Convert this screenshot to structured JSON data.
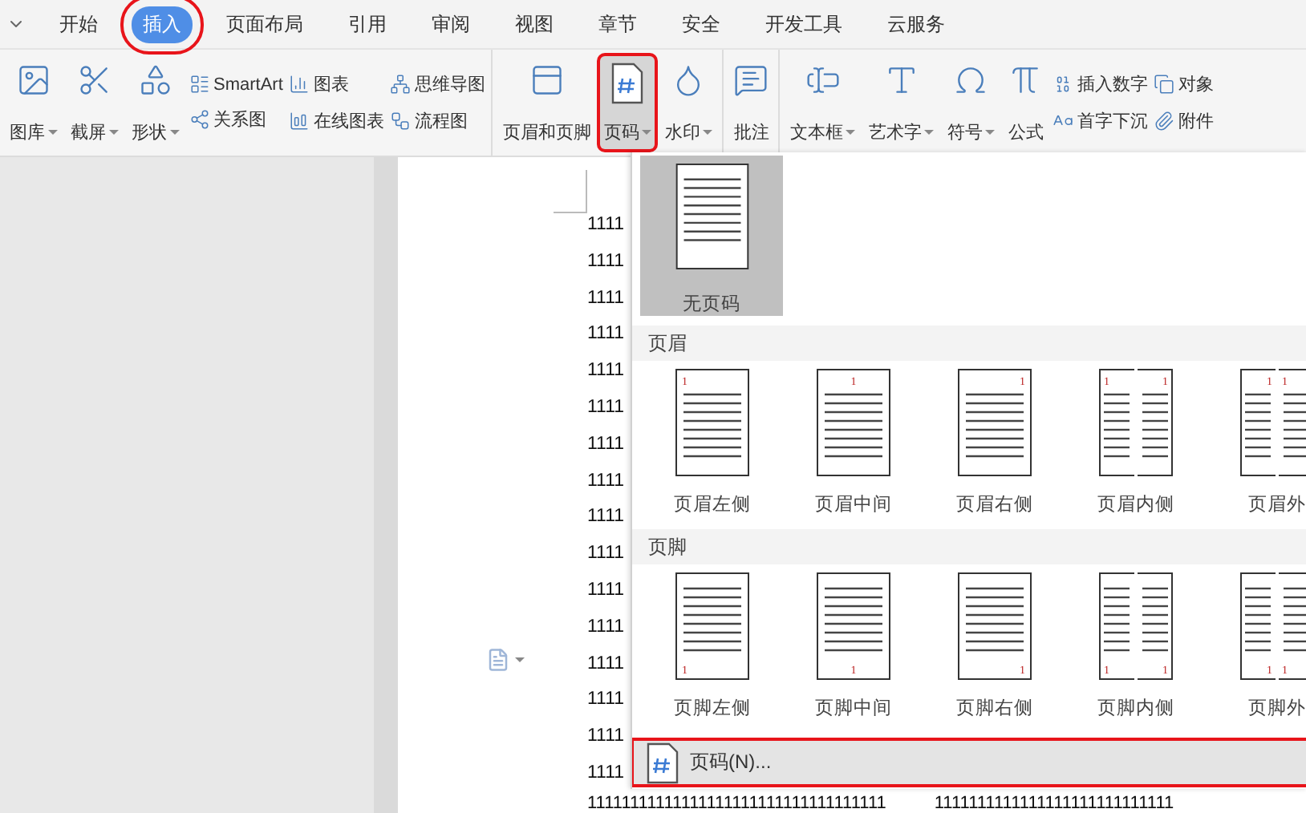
{
  "tabs": [
    {
      "label": "开始",
      "selected": false,
      "highlighted": false
    },
    {
      "label": "插入",
      "selected": true,
      "highlighted": true
    },
    {
      "label": "页面布局",
      "selected": false,
      "highlighted": false
    },
    {
      "label": "引用",
      "selected": false,
      "highlighted": false
    },
    {
      "label": "审阅",
      "selected": false,
      "highlighted": false
    },
    {
      "label": "视图",
      "selected": false,
      "highlighted": false
    },
    {
      "label": "章节",
      "selected": false,
      "highlighted": false
    },
    {
      "label": "安全",
      "selected": false,
      "highlighted": false
    },
    {
      "label": "开发工具",
      "selected": false,
      "highlighted": false
    },
    {
      "label": "云服务",
      "selected": false,
      "highlighted": false
    }
  ],
  "ribbon": {
    "groups": [
      {
        "items": [
          {
            "kind": "large",
            "label": "图库",
            "dropdown": true,
            "pressed": false,
            "highlighted": false
          },
          {
            "kind": "large",
            "label": "截屏",
            "dropdown": true,
            "pressed": false,
            "highlighted": false
          },
          {
            "kind": "large",
            "label": "形状",
            "dropdown": true,
            "pressed": false,
            "highlighted": false
          },
          {
            "kind": "stack",
            "entries": [
              {
                "label": "SmartArt"
              },
              {
                "label": "关系图"
              }
            ]
          },
          {
            "kind": "stack",
            "entries": [
              {
                "label": "图表"
              },
              {
                "label": "在线图表"
              }
            ]
          },
          {
            "kind": "stack",
            "entries": [
              {
                "label": "思维导图"
              },
              {
                "label": "流程图"
              }
            ]
          }
        ]
      },
      {
        "items": [
          {
            "kind": "large",
            "label": "页眉和页脚",
            "dropdown": false,
            "pressed": false,
            "highlighted": false
          },
          {
            "kind": "large",
            "label": "页码",
            "dropdown": true,
            "pressed": true,
            "highlighted": true
          },
          {
            "kind": "large",
            "label": "水印",
            "dropdown": true,
            "pressed": false,
            "highlighted": false
          }
        ]
      },
      {
        "items": [
          {
            "kind": "large",
            "label": "批注",
            "dropdown": false,
            "pressed": false,
            "highlighted": false
          }
        ]
      },
      {
        "items": [
          {
            "kind": "large",
            "label": "文本框",
            "dropdown": true,
            "pressed": false,
            "highlighted": false
          },
          {
            "kind": "large",
            "label": "艺术字",
            "dropdown": true,
            "pressed": false,
            "highlighted": false
          },
          {
            "kind": "large",
            "label": "符号",
            "dropdown": true,
            "pressed": false,
            "highlighted": false
          },
          {
            "kind": "large",
            "label": "公式",
            "dropdown": false,
            "pressed": false,
            "highlighted": false
          },
          {
            "kind": "stack",
            "entries": [
              {
                "label": "插入数字"
              },
              {
                "label": "首字下沉"
              }
            ]
          },
          {
            "kind": "stack",
            "entries": [
              {
                "label": "对象"
              },
              {
                "label": "附件"
              }
            ]
          }
        ]
      }
    ]
  },
  "document": {
    "lines": [
      "1111",
      "1111",
      "1111",
      "1111",
      "1111",
      "1111",
      "1111",
      "1111",
      "1111",
      "1111",
      "1111",
      "1111",
      "1111",
      "1111",
      "1111",
      "1111"
    ],
    "last_line": [
      "11111111111111111111111111111111111",
      "1111111111111111111111111111"
    ]
  },
  "dropdown": {
    "none_option": {
      "label": "无页码",
      "selected": true
    },
    "sections": [
      {
        "title": "页眉",
        "kind": "header",
        "options": [
          {
            "label": "页眉左侧",
            "kind": "left",
            "numbers": [
              "1"
            ],
            "selected": false
          },
          {
            "label": "页眉中间",
            "kind": "center",
            "numbers": [
              "1"
            ],
            "selected": false
          },
          {
            "label": "页眉右侧",
            "kind": "right",
            "numbers": [
              "1"
            ],
            "selected": false
          },
          {
            "label": "页眉内侧",
            "kind": "inside",
            "numbers": [
              "1",
              "1"
            ],
            "selected": false
          },
          {
            "label": "页眉外",
            "kind": "outside",
            "numbers": [
              "1",
              "1"
            ],
            "selected": false
          }
        ]
      },
      {
        "title": "页脚",
        "kind": "footer",
        "options": [
          {
            "label": "页脚左侧",
            "kind": "left",
            "numbers": [
              "1"
            ],
            "selected": false
          },
          {
            "label": "页脚中间",
            "kind": "center",
            "numbers": [
              "1"
            ],
            "selected": false
          },
          {
            "label": "页脚右侧",
            "kind": "right",
            "numbers": [
              "1"
            ],
            "selected": false
          },
          {
            "label": "页脚内侧",
            "kind": "inside",
            "numbers": [
              "1",
              "1"
            ],
            "selected": false
          },
          {
            "label": "页脚外",
            "kind": "outside",
            "numbers": [
              "1",
              "1"
            ],
            "selected": false
          }
        ]
      }
    ],
    "footer_item": {
      "label": "页码(N)...",
      "highlighted": true
    }
  }
}
